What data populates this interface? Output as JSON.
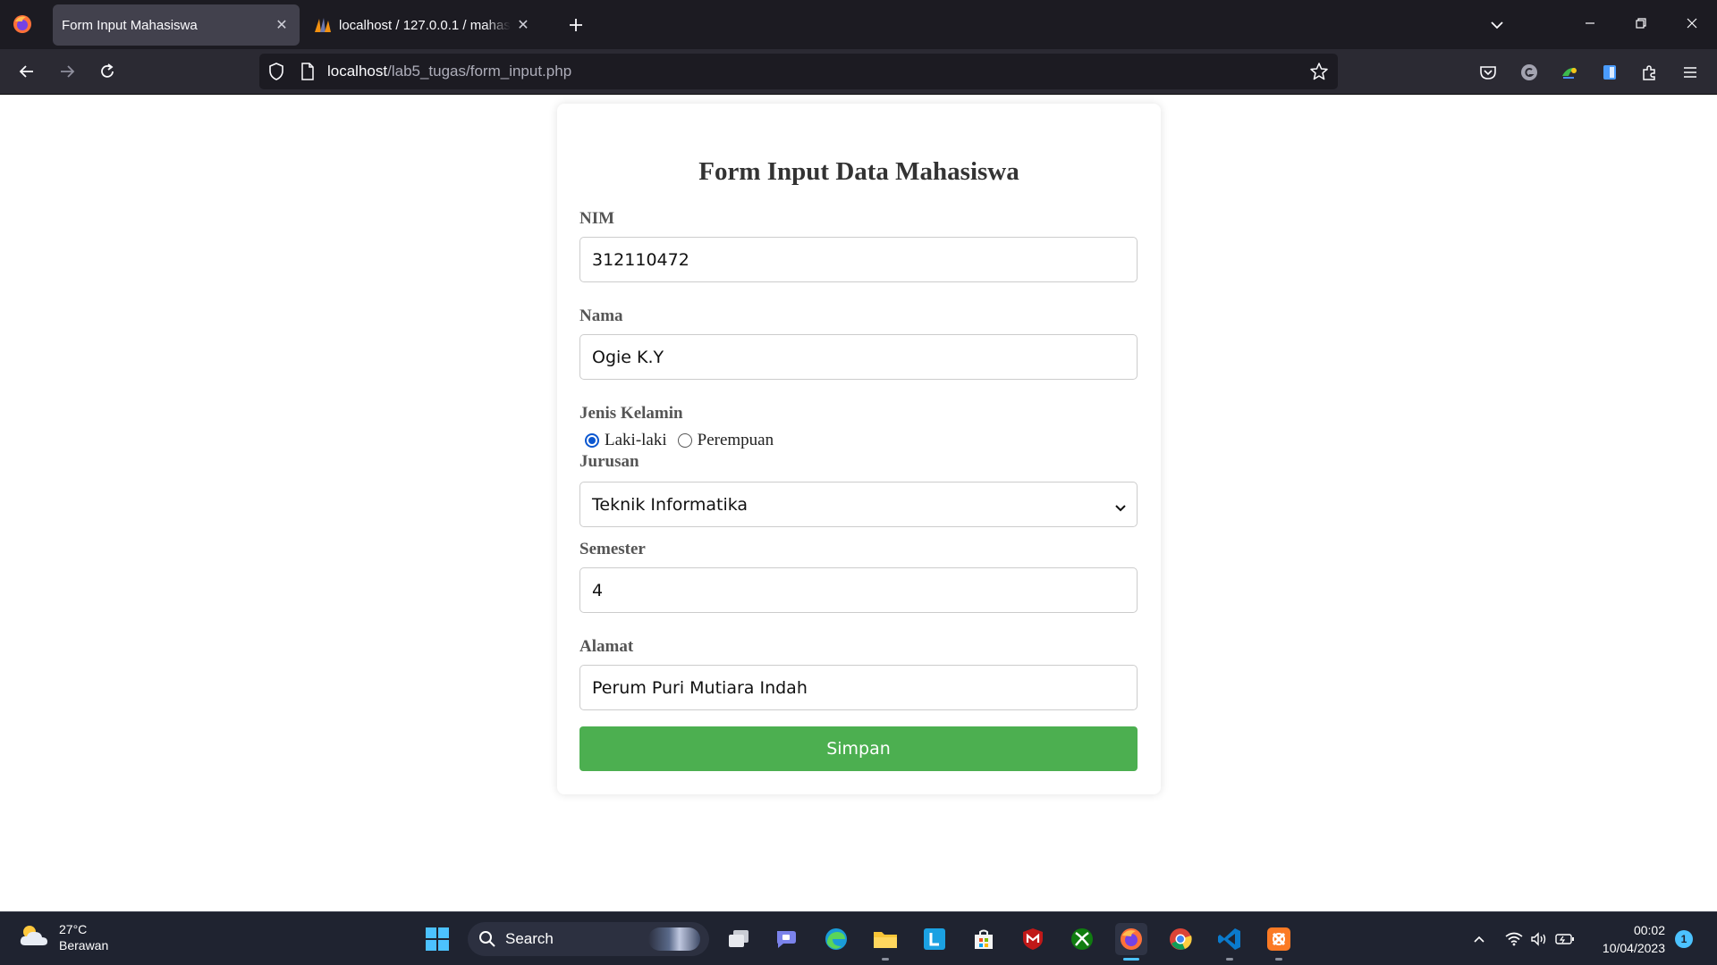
{
  "browser": {
    "tabs": [
      {
        "title": "Form Input Mahasiswa",
        "active": true
      },
      {
        "title": "localhost / 127.0.0.1 / mahasiswa",
        "active": false
      }
    ],
    "url_host": "localhost",
    "url_path": "/lab5_tugas/form_input.php"
  },
  "form": {
    "title": "Form Input Data Mahasiswa",
    "nim_label": "NIM",
    "nim_value": "312110472",
    "nama_label": "Nama",
    "nama_value": "Ogie K.Y",
    "gender_label": "Jenis Kelamin",
    "gender_options": [
      "Laki-laki",
      "Perempuan"
    ],
    "gender_selected": "Laki-laki",
    "jurusan_label": "Jurusan",
    "jurusan_value": "Teknik Informatika",
    "semester_label": "Semester",
    "semester_value": "4",
    "alamat_label": "Alamat",
    "alamat_value": "Perum Puri Mutiara Indah",
    "submit_label": "Simpan"
  },
  "taskbar": {
    "weather_temp": "27°C",
    "weather_desc": "Berawan",
    "search_label": "Search",
    "clock_time": "00:02",
    "clock_date": "10/04/2023",
    "notification_count": "1",
    "accent": "#4cc2ff"
  },
  "colors": {
    "submit_button": "#4caf50",
    "radio_checked": "#0b57d0"
  }
}
